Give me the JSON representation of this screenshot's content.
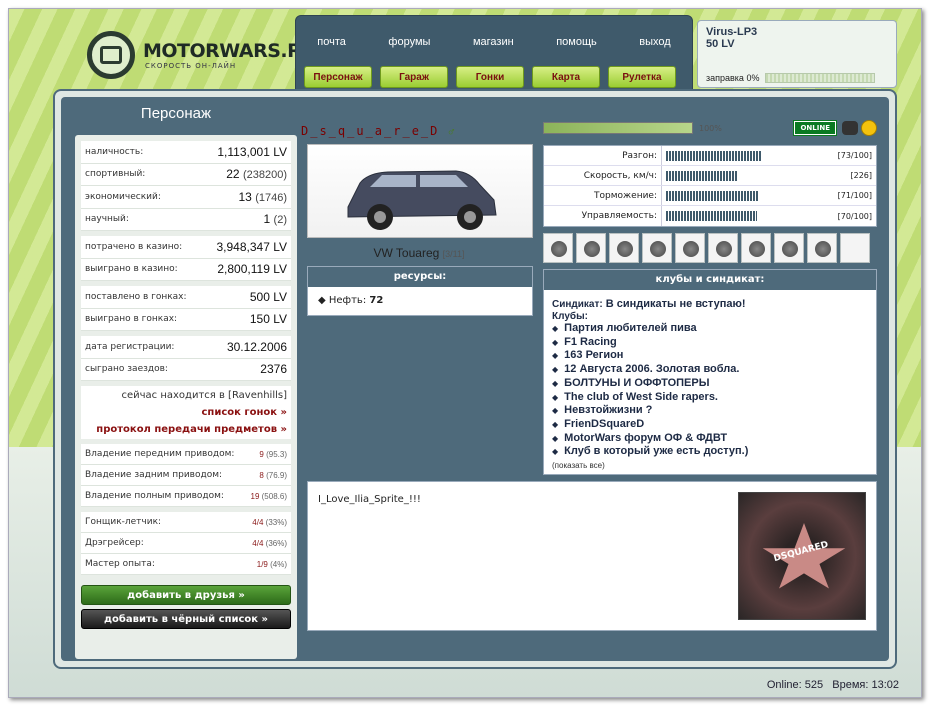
{
  "logo": {
    "title": "MOTORWARS.RU",
    "subtitle": "СКОРОСТЬ ОН-ЛАЙН"
  },
  "nav_top": [
    "почта",
    "форумы",
    "магазин",
    "помощь",
    "выход"
  ],
  "nav_btns": [
    "Персонаж",
    "Гараж",
    "Гонки",
    "Карта",
    "Рулетка"
  ],
  "user": {
    "name": "Virus-LP3",
    "money": "50 LV",
    "fuel_label": "заправка 0%",
    "fuel_level": 0
  },
  "left": {
    "title": "Персонаж",
    "groups": [
      [
        {
          "label": "наличность:",
          "value": "1,113,001 LV"
        },
        {
          "label": "спортивный:",
          "value": "22",
          "extra": "(238200)"
        },
        {
          "label": "экономический:",
          "value": "13",
          "extra": "(1746)"
        },
        {
          "label": "научный:",
          "value": "1",
          "extra": "(2)"
        }
      ],
      [
        {
          "label": "потрачено в казино:",
          "value": "3,948,347 LV"
        },
        {
          "label": "выиграно в казино:",
          "value": "2,800,119 LV"
        }
      ],
      [
        {
          "label": "поставлено в гонках:",
          "value": "500 LV"
        },
        {
          "label": "выиграно в гонках:",
          "value": "150 LV"
        }
      ],
      [
        {
          "label": "дата регистрации:",
          "value": "30.12.2006"
        },
        {
          "label": "сыграно заездов:",
          "value": "2376"
        }
      ]
    ],
    "location_text": "сейчас находится в [Ravenhills]",
    "race_list_link": "список гонок »",
    "transfer_link": "протокол передачи предметов »",
    "drive_stats": [
      {
        "label": "Владение передним приводом:",
        "value": "9",
        "extra": "(95.3)"
      },
      {
        "label": "Владение задним приводом:",
        "value": "8",
        "extra": "(76.9)"
      },
      {
        "label": "Владение полным приводом:",
        "value": "19",
        "extra": "(508.6)"
      }
    ],
    "ranks": [
      {
        "label": "Гонщик-летчик:",
        "value": "4/4",
        "extra": "(33%)"
      },
      {
        "label": "Дрэгрейсер:",
        "value": "4/4",
        "extra": "(36%)"
      },
      {
        "label": "Мастер опыта:",
        "value": "1/9",
        "extra": "(4%)"
      }
    ],
    "add_friend": "добавить в друзья »",
    "add_blacklist": "добавить в чёрный список »"
  },
  "mid": {
    "nickname": "D_s_q_u_a_r_e_D",
    "gender_icon": "male-icon",
    "car_name": "VW Touareg",
    "car_count": "[3/11]",
    "resources_title": "ресурсы:",
    "resource": "Нефть:",
    "resource_value": "72"
  },
  "right": {
    "progress_pct": "100%",
    "online_badge": "ONLINE",
    "specs": [
      {
        "label": "Разгон:",
        "value": "[73/100]",
        "level": 0.73
      },
      {
        "label": "Скорость, км/ч:",
        "value": "[226]",
        "level": 0.55
      },
      {
        "label": "Торможение:",
        "value": "[71/100]",
        "level": 0.71
      },
      {
        "label": "Управляемость:",
        "value": "[70/100]",
        "level": 0.7
      }
    ],
    "clubs_title": "клубы и синдикат:",
    "syndicate_label": "Синдикат:",
    "syndicate_value": "В синдикаты не вступаю!",
    "clubs_label": "Клубы:",
    "clubs": [
      "Партия любителей пива",
      "F1 Racing",
      "163 Регион",
      "12 Августа 2006. Золотая вобла.",
      "БОЛТУНЫ И ОФФТОПЕРЫ",
      "The club of West Side rapers.",
      "Невзтойжизни ?",
      "FrienDSquareD",
      "MotorWars форум ОФ & ФДВТ",
      "Клуб в который уже есть доступ.)"
    ],
    "show_all": "(показать все)"
  },
  "note": {
    "text": "I_Love_Ilia_Sprite_!!!",
    "image_text": "DSQUARED"
  },
  "footer": {
    "online": "Online: 525",
    "time": "Время: 13:02"
  },
  "colors": {
    "accent": "#4e6a7b",
    "green": "#9acd32",
    "link_red": "#8a1010"
  }
}
